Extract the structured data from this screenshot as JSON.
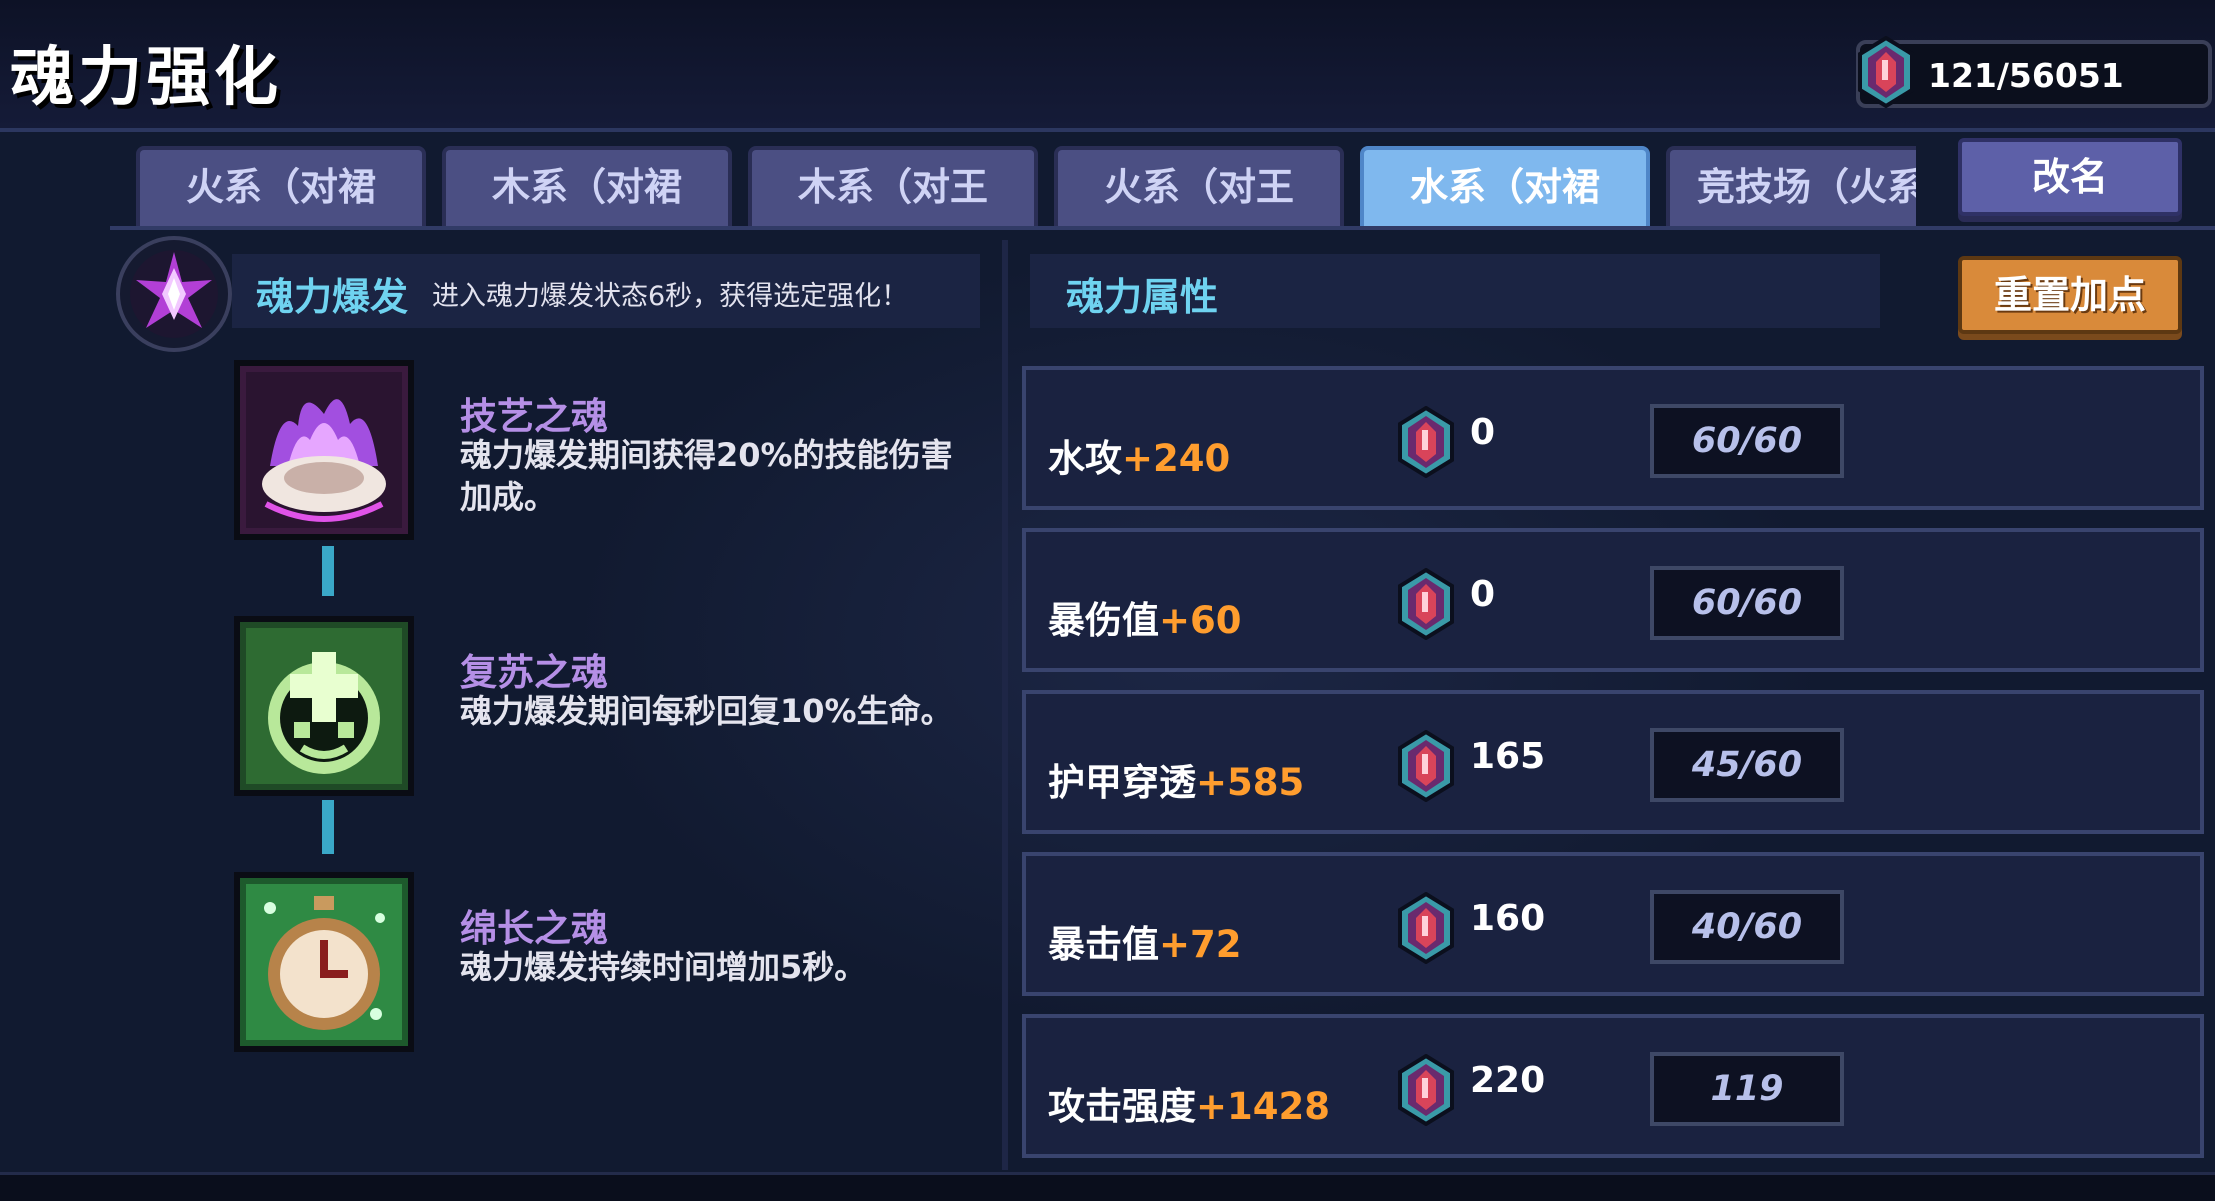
{
  "header": {
    "title": "魂力强化",
    "currency": "121/56051"
  },
  "tabs": [
    {
      "label": "火系（对裙",
      "active": false
    },
    {
      "label": "木系（对裙",
      "active": false
    },
    {
      "label": "木系（对王",
      "active": false
    },
    {
      "label": "火系（对王",
      "active": false
    },
    {
      "label": "水系（对裙",
      "active": true
    },
    {
      "label": "竞技场（火系",
      "active": false
    }
  ],
  "buttons": {
    "rename": "改名",
    "reset": "重置加点"
  },
  "burst": {
    "name": "魂力爆发",
    "desc": "进入魂力爆发状态6秒，获得选定强化！"
  },
  "skills": [
    {
      "name": "技艺之魂",
      "desc": "魂力爆发期间获得20%的技能伤害加成。",
      "icon": "purple-flame-shell-icon"
    },
    {
      "name": "复苏之魂",
      "desc": "魂力爆发期间每秒回复10%生命。",
      "icon": "green-heal-face-icon"
    },
    {
      "name": "绵长之魂",
      "desc": "魂力爆发持续时间增加5秒。",
      "icon": "stopwatch-icon"
    }
  ],
  "attributes": {
    "title": "魂力属性",
    "rows": [
      {
        "name": "水攻",
        "bonus": "+240",
        "cost": "0",
        "level": "60/60"
      },
      {
        "name": "暴伤值",
        "bonus": "+60",
        "cost": "0",
        "level": "60/60"
      },
      {
        "name": "护甲穿透",
        "bonus": "+585",
        "cost": "165",
        "level": "45/60"
      },
      {
        "name": "暴击值",
        "bonus": "+72",
        "cost": "160",
        "level": "40/60"
      },
      {
        "name": "攻击强度",
        "bonus": "+1428",
        "cost": "220",
        "level": "119"
      }
    ]
  },
  "colors": {
    "accent_cyan": "#6fd3f0",
    "skill_name_purple": "#b58fe6",
    "bonus_orange": "#ff9d2e",
    "active_tab": "#7fb8ee",
    "reset_button": "#d98a3a"
  }
}
